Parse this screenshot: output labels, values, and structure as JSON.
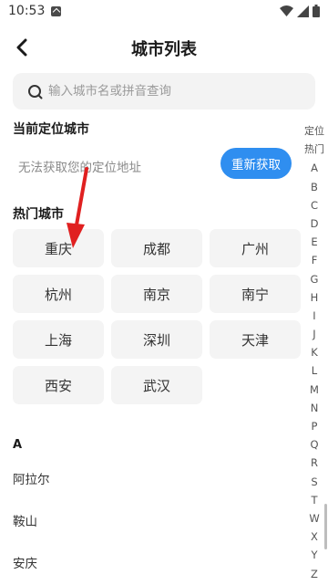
{
  "status_bar": {
    "time": "10:53"
  },
  "header": {
    "title": "城市列表"
  },
  "search": {
    "placeholder": "输入城市名或拼音查询"
  },
  "current_location": {
    "title": "当前定位城市",
    "message": "无法获取您的定位地址",
    "retry_label": "重新获取"
  },
  "hot_cities": {
    "title": "热门城市",
    "items": [
      "重庆",
      "成都",
      "广州",
      "杭州",
      "南京",
      "南宁",
      "上海",
      "深圳",
      "天津",
      "西安",
      "武汉"
    ]
  },
  "city_list": {
    "letter": "A",
    "items": [
      "阿拉尔",
      "鞍山",
      "安庆"
    ]
  },
  "index_bar": {
    "items": [
      "定位",
      "热门",
      "A",
      "B",
      "C",
      "D",
      "E",
      "F",
      "G",
      "H",
      "I",
      "J",
      "K",
      "L",
      "M",
      "N",
      "P",
      "Q",
      "R",
      "S",
      "T",
      "W",
      "X",
      "Y",
      "Z"
    ]
  },
  "colors": {
    "accent": "#2f8ef0",
    "annotation_arrow": "#e02020"
  }
}
